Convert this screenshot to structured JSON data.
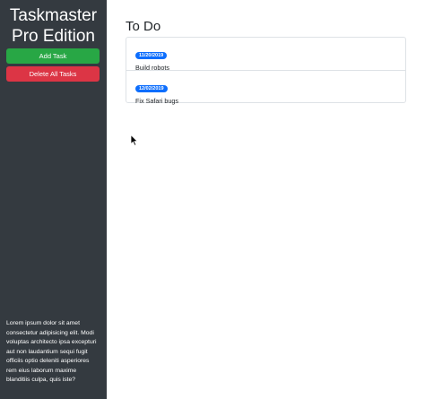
{
  "sidebar": {
    "app_title_line1": "Taskmaster",
    "app_title_line2": "Pro Edition",
    "add_task_label": "Add Task",
    "delete_all_label": "Delete All Tasks",
    "description": "Lorem ipsum dolor sit amet consectetur adipisicing elit. Modi voluptas architecto ipsa excepturi aut non laudantium sequi fugit officiis optio deleniti asperiores rem eius laborum maxime blanditiis culpa, quis iste?"
  },
  "main": {
    "section_title": "To Do",
    "tasks": [
      {
        "date": "11/20/2019",
        "text": "Build robots"
      },
      {
        "date": "12/02/2019",
        "text": "Fix Safari bugs"
      }
    ]
  },
  "colors": {
    "sidebar_bg": "#343a40",
    "add_button": "#28a745",
    "delete_button": "#dc3545",
    "date_badge": "#0d6efd"
  },
  "icons": {
    "cursor": "mouse-pointer-icon"
  }
}
